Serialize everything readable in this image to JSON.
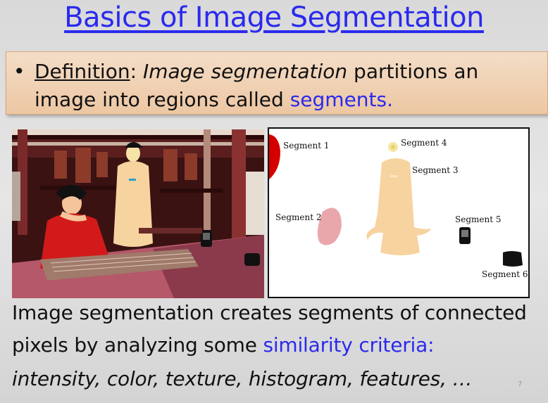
{
  "slide": {
    "title": "Basics of Image Segmentation",
    "definition": {
      "bullet": "•",
      "term": "Definition",
      "colon": ":",
      "italic_phrase": "Image segmentation",
      "text_mid": " partitions an image into regions called ",
      "highlight": "segments."
    },
    "segments": [
      {
        "label": "Segment 1"
      },
      {
        "label": "Segment 2"
      },
      {
        "label": "Segment 3"
      },
      {
        "label": "Segment 4"
      },
      {
        "label": "Segment 5"
      },
      {
        "label": "Segment 6"
      }
    ],
    "body": {
      "line1": "Image segmentation creates segments of connected",
      "line2_prefix": "pixels by analyzing some ",
      "line2_highlight": "similarity criteria:",
      "line3": "intensity, color, texture, histogram, features, …"
    },
    "page_number": "7",
    "colors": {
      "title_blue": "#2a2aee",
      "definition_box": "#ecc7a3",
      "segment_red": "#d40000",
      "segment_skin": "#f7d3a0",
      "segment_pink": "#e9a7ac",
      "segment_black": "#111111"
    }
  }
}
